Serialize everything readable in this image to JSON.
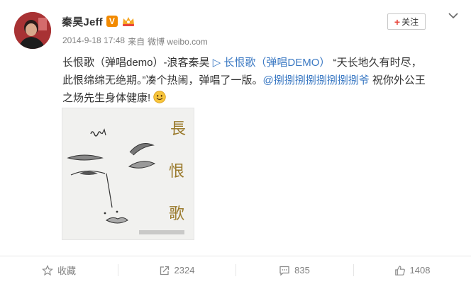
{
  "user": {
    "name": "秦昊Jeff",
    "verified_badge": "V"
  },
  "meta": {
    "time": "2014-9-18 17:48",
    "source_prefix": "来自",
    "source": "微博 weibo.com"
  },
  "follow": {
    "plus": "+",
    "label": "关注"
  },
  "post": {
    "line1_a": "长恨歌（弹唱demo）-浪客秦昊",
    "play_symbol": "▷",
    "video_link": "长恨歌（弹唱DEMO）",
    "line1_b": "“天长地久有时尽，",
    "line2_a": "此恨绵绵无绝期。”凑个热闹，弹唱了一版。",
    "mention": "@捌捌捌捌捌捌捌捌爷",
    "line2_b": " 祝你外公王",
    "line3": "之炀先生身体健康!"
  },
  "image": {
    "calligraphy": [
      "長",
      "恨",
      "歌"
    ]
  },
  "actions": {
    "favorite": "收藏",
    "repost": "2324",
    "comment": "835",
    "like": "1408"
  },
  "colors": {
    "link": "#3b79c3",
    "verified": "#f28a00",
    "follow_plus": "#e8463b",
    "meta_gray": "#808080"
  }
}
